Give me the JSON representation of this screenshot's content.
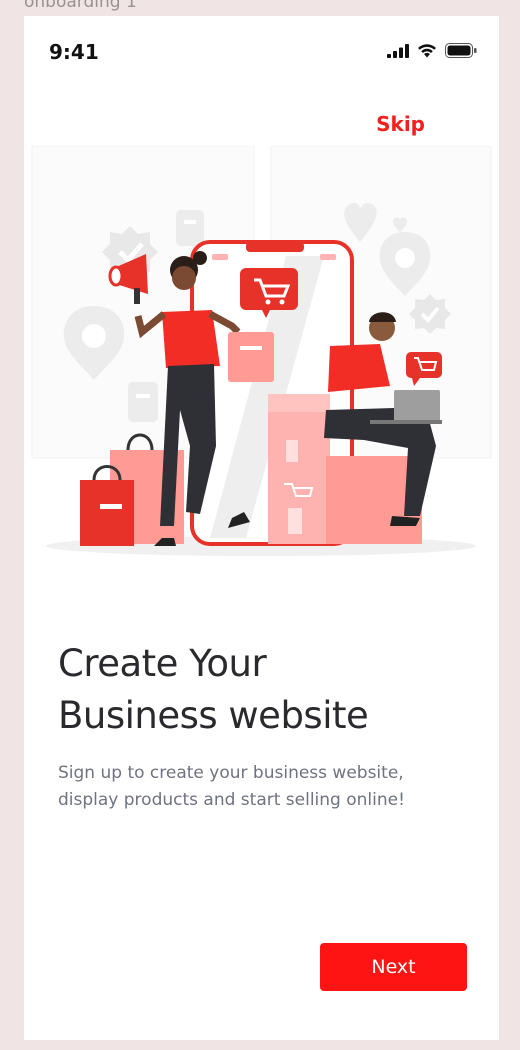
{
  "frame": {
    "label": "onboarding 1"
  },
  "status_bar": {
    "time": "9:41",
    "icons": [
      "cellular-signal-icon",
      "wifi-icon",
      "battery-icon"
    ]
  },
  "header": {
    "skip_label": "Skip"
  },
  "illustration": {
    "name": "online-shopping-illustration",
    "icons": [
      "megaphone-icon",
      "shopping-cart-icon",
      "location-pin-icon",
      "check-badge-icon",
      "heart-icon",
      "shopping-bag-icon",
      "laptop-icon"
    ]
  },
  "content": {
    "title_line1": "Create Your",
    "title_line2": "Business website",
    "subtitle_line1": "Sign up to create your business website,",
    "subtitle_line2": "display products and start selling online!"
  },
  "footer": {
    "next_label": "Next"
  },
  "colors": {
    "accent": "#ff1414",
    "skip": "#f1201c",
    "title": "#2a2a2e",
    "subtitle": "#6f7380",
    "frame_background": "#f1e4e4"
  }
}
